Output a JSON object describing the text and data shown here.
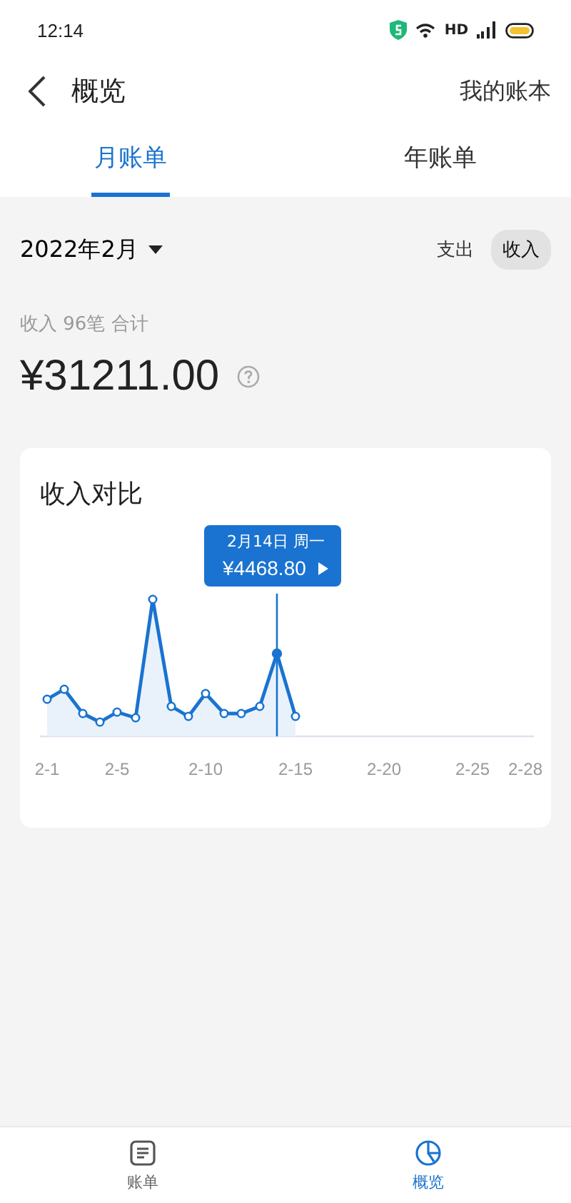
{
  "status_bar": {
    "time": "12:14",
    "network": "HD"
  },
  "header": {
    "title": "概览",
    "action": "我的账本"
  },
  "tabs": [
    {
      "label": "月账单",
      "selected": true
    },
    {
      "label": "年账单",
      "selected": false
    }
  ],
  "period": {
    "label": "2022年2月"
  },
  "type_toggle": [
    {
      "label": "支出",
      "selected": false
    },
    {
      "label": "收入",
      "selected": true
    }
  ],
  "summary": {
    "caption": "收入 96笔 合计",
    "amount": "¥31211.00"
  },
  "chart_card": {
    "title": "收入对比",
    "tooltip": {
      "date": "2月14日 周一",
      "value": "¥4468.80"
    },
    "x_labels": [
      "2-1",
      "2-5",
      "2-10",
      "2-15",
      "2-20",
      "2-25",
      "2-28"
    ]
  },
  "bottom_nav": [
    {
      "label": "账单",
      "selected": false
    },
    {
      "label": "概览",
      "selected": true
    }
  ]
}
